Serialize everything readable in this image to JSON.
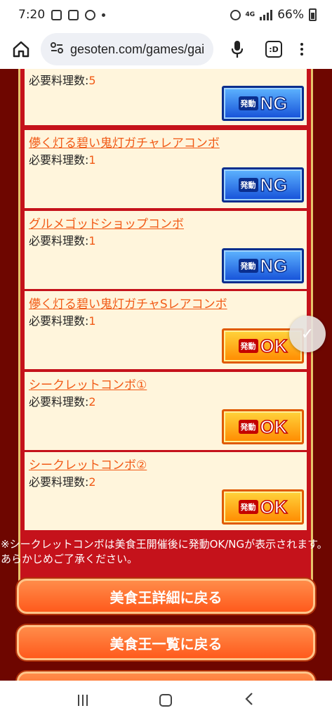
{
  "status_bar": {
    "time": "7:20",
    "network": "4G",
    "battery": "66%",
    "icons": [
      "image-icon",
      "news-icon",
      "chrome-icon",
      "notification-dot-icon",
      "alarm-icon",
      "signal-icon",
      "battery-icon"
    ]
  },
  "browser": {
    "url": "gesoten.com/games/gai",
    "tabs_label": ":D",
    "icons": [
      "home-icon",
      "site-settings-icon",
      "mic-icon",
      "tabs-icon",
      "menu-icon"
    ]
  },
  "rows": [
    {
      "title": "",
      "req_label": "必要料理数:",
      "req_value": "5",
      "status": "NG"
    },
    {
      "title": "儚く灯る碧い鬼灯ガチャレアコンボ",
      "req_label": "必要料理数:",
      "req_value": "1",
      "status": "NG"
    },
    {
      "title": "グルメゴッドショップコンボ",
      "req_label": "必要料理数:",
      "req_value": "1",
      "status": "NG"
    },
    {
      "title": "儚く灯る碧い鬼灯ガチャSレアコンボ",
      "req_label": "必要料理数:",
      "req_value": "1",
      "status": "OK"
    },
    {
      "title": "シークレットコンボ①",
      "req_label": "必要料理数:",
      "req_value": "2",
      "status": "OK"
    },
    {
      "title": "シークレットコンボ②",
      "req_label": "必要料理数:",
      "req_value": "2",
      "status": "OK"
    }
  ],
  "badge_prefix": "発動",
  "note": "※シークレットコンボは美食王開催後に発動OK/NGが表示されます。あらかじめご了承ください。",
  "buttons": {
    "back_detail": "美食王詳細に戻る",
    "back_list": "美食王一覧に戻る"
  },
  "colors": {
    "background": "#6e0600",
    "frame": "#c5121b",
    "row_bg": "#fff5dc",
    "link": "#f15a16",
    "ng": "#1550d8",
    "ok": "#ff8a00"
  }
}
